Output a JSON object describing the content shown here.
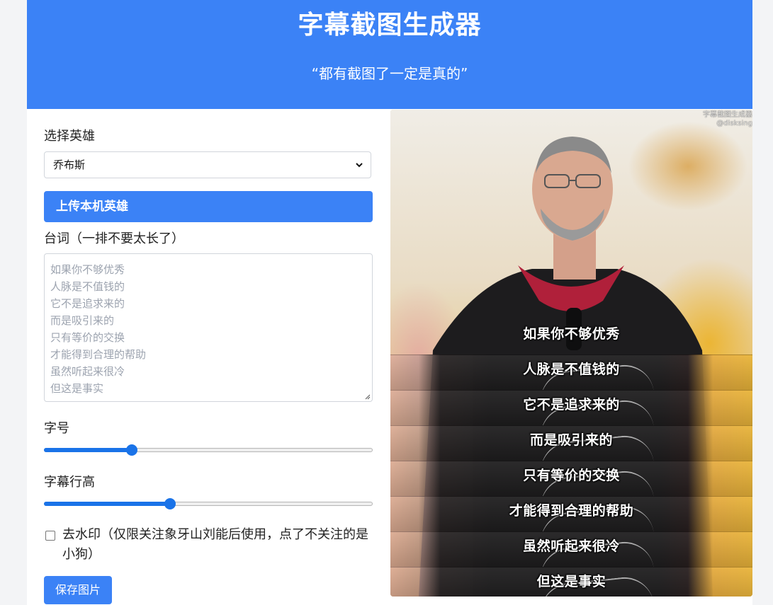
{
  "header": {
    "title": "字幕截图生成器",
    "subtitle": "“都有截图了一定是真的”",
    "color": "#3b82f6"
  },
  "form": {
    "hero_label": "选择英雄",
    "hero_selected": "乔布斯",
    "upload_label": "上传本机英雄",
    "lines_label": "台词（一排不要太长了）",
    "lines_placeholder": [
      "如果你不够优秀",
      "人脉是不值钱的",
      "它不是追求来的",
      "而是吸引来的",
      "只有等价的交换",
      "才能得到合理的帮助",
      "虽然听起来很冷",
      "但这是事实"
    ],
    "font_size_label": "字号",
    "font_size_level": 0.26,
    "line_height_label": "字幕行高",
    "line_height_level": 0.38,
    "watermark_label": "去水印（仅限关注象牙山刘能后使用，点了不关注的是小狗）",
    "watermark_checked": false,
    "save_label": "保存图片"
  },
  "preview": {
    "watermark_line1": "字幕截图生成器",
    "watermark_line2": "@disksing",
    "subtitles": [
      "如果你不够优秀",
      "人脉是不值钱的",
      "它不是追求来的",
      "而是吸引来的",
      "只有等价的交换",
      "才能得到合理的帮助",
      "虽然听起来很冷",
      "但这是事实"
    ]
  },
  "colors": {
    "accent": "#3b82f6",
    "slider": "#1a73e8"
  },
  "icons": [
    "chevron-down-icon",
    "resize-grip-icon"
  ]
}
